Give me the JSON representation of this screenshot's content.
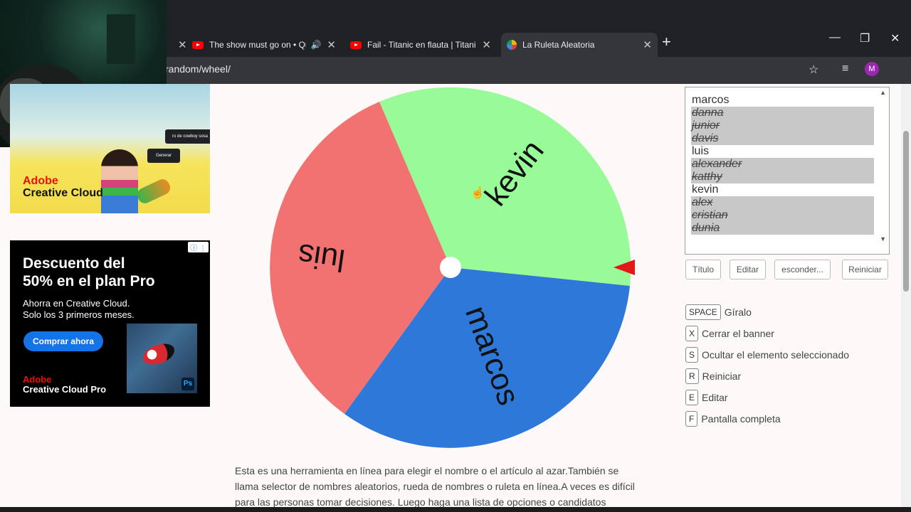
{
  "browser": {
    "tabs": [
      {
        "title": "The show must go on • Qu",
        "icon": "youtube-icon",
        "audio": true
      },
      {
        "title": "Fail - Titanic en flauta | Titanic fl",
        "icon": "youtube-icon",
        "audio": false
      },
      {
        "title": "La Ruleta Aleatoria",
        "icon": "wheel-favicon",
        "active": true
      }
    ],
    "new_tab": "+",
    "url": "random/wheel/",
    "profile_initial": "M"
  },
  "ads": {
    "top": {
      "brand_line1": "Adobe",
      "brand_line2": "Creative Cloud",
      "tag1": "ro de cowboy sosa",
      "tag2": "Generar"
    },
    "bottom": {
      "headline_line1": "Descuento del",
      "headline_line2": "50% en el plan Pro",
      "sub_line1": "Ahorra en Creative Cloud.",
      "sub_line2": "Solo los 3 primeros meses.",
      "cta": "Comprar ahora",
      "brand_line1": "Adobe",
      "brand_line2": "Creative Cloud Pro",
      "ps_label": "Ps"
    }
  },
  "wheel": {
    "segments": [
      {
        "label": "kevin",
        "color": "#98fb98"
      },
      {
        "label": "marcos",
        "color": "#2d78d8"
      },
      {
        "label": "luis",
        "color": "#f27272"
      }
    ],
    "pointer_color": "#e01818"
  },
  "names_list": [
    {
      "name": "marcos",
      "hidden": false
    },
    {
      "name": "danna",
      "hidden": true
    },
    {
      "name": "junior",
      "hidden": true
    },
    {
      "name": "davis",
      "hidden": true
    },
    {
      "name": "luis",
      "hidden": false
    },
    {
      "name": "alexander",
      "hidden": true
    },
    {
      "name": "katthy",
      "hidden": true
    },
    {
      "name": "kevin",
      "hidden": false
    },
    {
      "name": "alex",
      "hidden": true
    },
    {
      "name": "cristian",
      "hidden": true
    },
    {
      "name": "dunia",
      "hidden": true
    }
  ],
  "buttons": {
    "title": "Título",
    "edit": "Editar",
    "hide": "esconder...",
    "reset": "Reiniciar"
  },
  "shortcuts": [
    {
      "key": "SPACE",
      "label": "Gíralo"
    },
    {
      "key": "X",
      "label": "Cerrar el banner"
    },
    {
      "key": "S",
      "label": "Ocultar el elemento seleccionado"
    },
    {
      "key": "R",
      "label": "Reiniciar"
    },
    {
      "key": "E",
      "label": "Editar"
    },
    {
      "key": "F",
      "label": "Pantalla completa"
    }
  ],
  "description": {
    "line1": "Esta es una herramienta en línea para elegir el nombre o el artículo al azar.También se",
    "line2": "llama selector de nombres aleatorios, rueda de nombres o ruleta en línea.A veces es difícil",
    "line3": "para las personas tomar decisiones. Luego haga una lista de opciones o candidatos"
  }
}
